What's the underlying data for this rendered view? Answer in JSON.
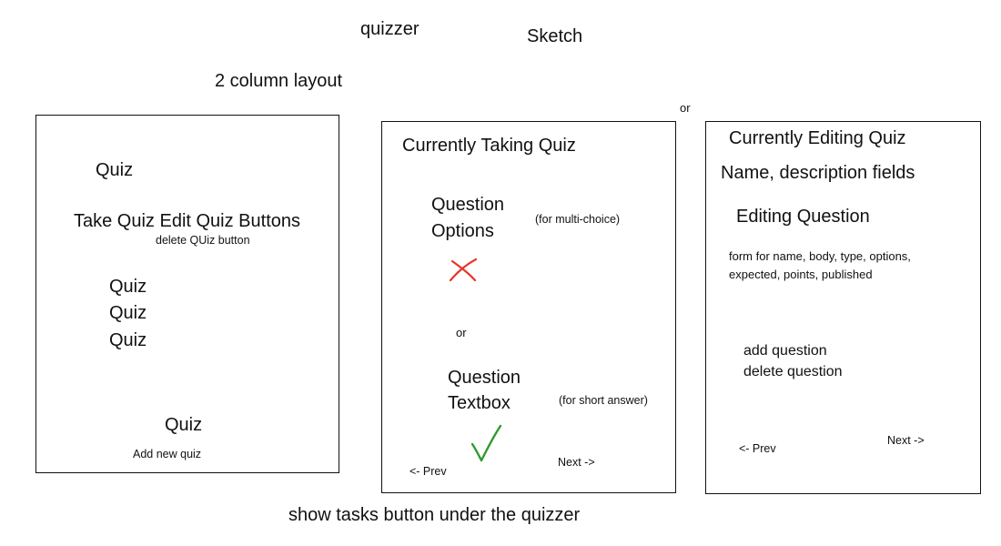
{
  "header": {
    "app_name": "quizzer",
    "sketch_label": "Sketch",
    "layout_note": "2 column layout",
    "or_between": "or"
  },
  "panel_quiz_list": {
    "title": "Quiz",
    "buttons_line": "Take Quiz Edit Quiz Buttons",
    "delete_line": "delete QUiz button",
    "items": [
      "Quiz",
      "Quiz",
      "Quiz"
    ],
    "footer_quiz": "Quiz",
    "add_new": "Add new quiz"
  },
  "panel_taking": {
    "title": "Currently Taking Quiz",
    "q1_line1": "Question",
    "q1_line2": "Options",
    "q1_note": "(for multi-choice)",
    "or_label": "or",
    "q2_line1": "Question",
    "q2_line2": "Textbox",
    "q2_note": "(for short answer)",
    "prev": "<- Prev",
    "next": "Next ->",
    "colors": {
      "wrong_mark": "#e8352b",
      "right_mark": "#2e9a2e"
    },
    "icons": {
      "wrong": "red-x-icon",
      "right": "green-checkmark-icon"
    }
  },
  "panel_editing": {
    "title": "Currently Editing Quiz",
    "fields_line": "Name, description fields",
    "editing_question": "Editing Question",
    "form_line1": "form for name, body, type, options,",
    "form_line2": "expected, points, published",
    "add_question": "add question",
    "delete_question": "delete question",
    "prev": "<- Prev",
    "next": "Next ->"
  },
  "footer_note": "show tasks button under the quizzer"
}
